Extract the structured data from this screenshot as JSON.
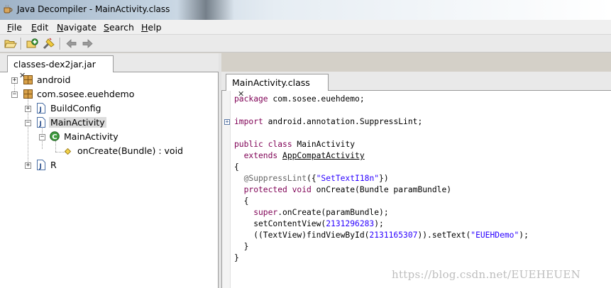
{
  "window": {
    "title": "Java Decompiler - MainActivity.class"
  },
  "menu": [
    "File",
    "Edit",
    "Navigate",
    "Search",
    "Help"
  ],
  "toolbar": {
    "buttons": [
      "open-file-icon",
      "open-type-icon",
      "search-icon",
      "back-arrow-icon",
      "forward-arrow-icon"
    ]
  },
  "left_panel": {
    "tab_label": "classes-dex2jar.jar",
    "tab_close": "✕",
    "tree": [
      {
        "label": "android",
        "icon": "package-icon"
      },
      {
        "label": "com.sosee.euehdemo",
        "icon": "package-icon"
      },
      {
        "label": "BuildConfig",
        "icon": "java-file-icon"
      },
      {
        "label": "MainActivity",
        "icon": "java-file-icon"
      },
      {
        "label": "MainActivity",
        "icon": "class-icon"
      },
      {
        "label": "onCreate(Bundle) : void",
        "icon": "method-icon"
      },
      {
        "label": "R",
        "icon": "java-file-icon"
      }
    ]
  },
  "editor": {
    "tab_label": "MainActivity.class",
    "tab_close": "✕",
    "code": {
      "package_kw": "package",
      "package_name": " com.sosee.euehdemo;",
      "import_kw": "import",
      "import_name": " android.annotation.SuppressLint;",
      "public_kw": "public class",
      "class_name": " MainActivity",
      "extends_kw": "extends",
      "super_class": "AppCompatActivity",
      "open_brace": "{",
      "annotation": "@SuppressLint",
      "annotation_open": "({",
      "annotation_str": "\"SetTextI18n\"",
      "annotation_close": "})",
      "method_kw": "protected void",
      "method_sig": " onCreate(Bundle paramBundle)",
      "method_open": "{",
      "super_kw": "super",
      "super_call": ".onCreate(paramBundle);",
      "set_content": "setContentView(",
      "content_id": "2131296283",
      "set_content_end": ");",
      "textview_pre": "((TextView)findViewById(",
      "textview_id": "2131165307",
      "textview_mid": ")).setText(",
      "textview_str": "\"EUEHDemo\"",
      "textview_end": ");",
      "method_close": "}",
      "class_close": "}"
    }
  },
  "watermark": "https://blog.csdn.net/EUEHEUEN",
  "colors": {
    "keyword": "#7f0055",
    "string": "#2a00ff",
    "annotation": "#646464",
    "selection": "#dcdcdc"
  }
}
